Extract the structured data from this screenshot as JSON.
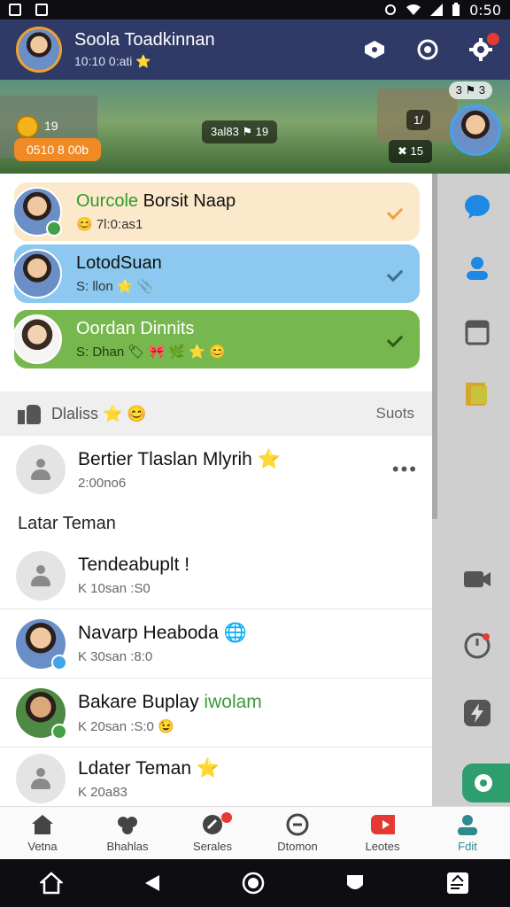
{
  "status_bar": {
    "time": "0:50"
  },
  "header": {
    "title": "Soola Toadkinnan",
    "subtitle": "10:10 0:ati ⭐"
  },
  "banner": {
    "coin_label": "19",
    "pill_label": "0510 8 00b",
    "center_label": "3al83 ⚑ 19",
    "score": "1/",
    "lives": "✖ 15",
    "top_right": "3  ⚑ 3"
  },
  "pinned_chats": [
    {
      "name_hl": "Ourcole",
      "name": " Borsit Naap",
      "meta": "😊 7l:0:as1"
    },
    {
      "name_hl": "",
      "name": "LotodSuan",
      "meta": "S: llon ⭐ 📎"
    },
    {
      "name_hl": "",
      "name": "Oordan Dinnits",
      "meta": "S: Dhan 🏷 🎀 🌿 ⭐ 😊"
    }
  ],
  "section": {
    "label": "Dlaliss ⭐ 😊",
    "right": "Suots"
  },
  "top_chat": {
    "name": "Bertier Tlaslan Mlyrih ⭐",
    "meta": "2:00no6",
    "more": "•••"
  },
  "friends_heading": "Latar Teman",
  "friends": [
    {
      "name": "Tendeabuplt",
      "name_suffix": "!",
      "meta": "K 10san :S0"
    },
    {
      "name": "Navarp Heaboda",
      "name_suffix": "🌐",
      "meta": "K 30san :8:0"
    },
    {
      "name": "Bakare Buplay",
      "name_hl": " iwolam",
      "meta": "K 20san :S:0 😉"
    },
    {
      "name": "Ldater Teman",
      "name_suffix": "⭐",
      "meta": "K 20a83"
    }
  ],
  "bottom_nav": [
    {
      "label": "Vetna"
    },
    {
      "label": "Bhahlas"
    },
    {
      "label": "Serales"
    },
    {
      "label": "Dtomon"
    },
    {
      "label": "Leotes"
    },
    {
      "label": "Fdit"
    }
  ],
  "colors": {
    "header_bg": "#2f3a66",
    "accent_green": "#2e9e6f",
    "accent_orange": "#f08a24",
    "badge_red": "#e53935"
  }
}
